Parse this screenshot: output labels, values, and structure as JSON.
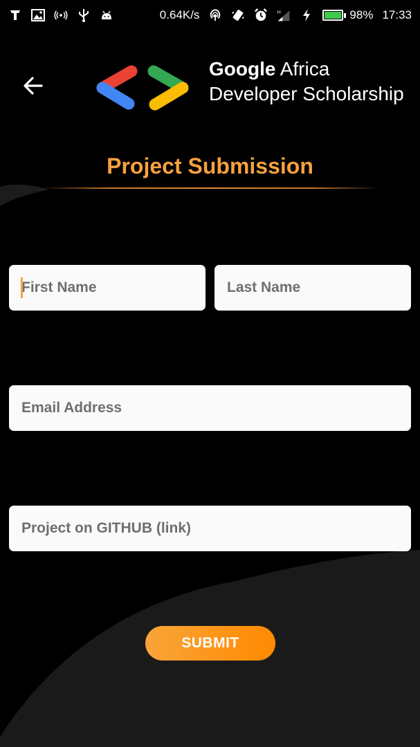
{
  "status_bar": {
    "network_speed": "0.64K/s",
    "battery_percent": "98%",
    "battery_level": 0.98,
    "time": "17:33",
    "network_type_label": "H",
    "left_icons": [
      "tiktok-icon",
      "image-icon",
      "hotspot-icon",
      "usb-icon",
      "android-icon"
    ],
    "right_icons": [
      "wifi-hotspot-icon",
      "vibrate-icon",
      "alarm-icon",
      "signal-icon",
      "charging-icon",
      "battery-icon"
    ]
  },
  "header": {
    "back_icon": "arrow-left-icon",
    "logo": "gads-logo-icon",
    "brand_line1_bold": "Google",
    "brand_line1_rest": " Africa",
    "brand_line2": "Developer Scholarship"
  },
  "page": {
    "title": "Project Submission"
  },
  "form": {
    "first_name_placeholder": "First Name",
    "last_name_placeholder": "Last Name",
    "email_placeholder": "Email Address",
    "github_placeholder": "Project on GITHUB (link)",
    "submit_label": "SUBMIT"
  },
  "colors": {
    "accent": "#f7a13e",
    "button_gradient_start": "#f9a43a",
    "button_gradient_end": "#ff8a00",
    "field_background": "#fafafa",
    "logo_red": "#ea4335",
    "logo_blue": "#4285f4",
    "logo_green": "#34a853",
    "logo_yellow": "#fbbc04"
  }
}
